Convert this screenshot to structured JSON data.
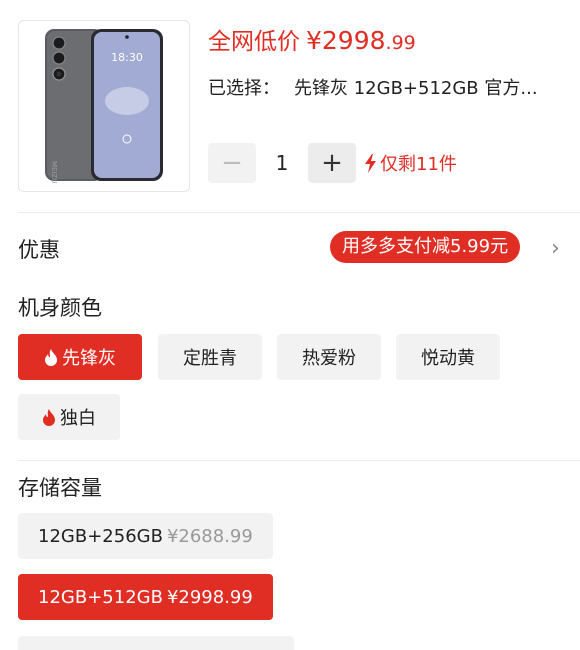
{
  "product": {
    "price_prefix": "全网低价",
    "price_main": "¥2998",
    "price_decimal": ".99",
    "selected_label": "已选择：",
    "selected_value": "先锋灰 12GB+512GB 官方...",
    "screen_time": "18:30",
    "brand_mark": "MEIZU"
  },
  "quantity": {
    "minus_label": "−",
    "value": "1",
    "plus_label": "+",
    "stock_text": "仅剩11件"
  },
  "promo": {
    "title": "优惠",
    "badge": "用多多支付减5.99元",
    "chevron": "›"
  },
  "color_section": {
    "title": "机身颜色",
    "options": [
      "先锋灰",
      "定胜青",
      "热爱粉",
      "悦动黄",
      "独白"
    ]
  },
  "storage_section": {
    "title": "存储容量",
    "options": [
      {
        "label": "12GB+256GB",
        "price": "¥2688.99"
      },
      {
        "label": "12GB+512GB",
        "price": "¥2998.99"
      }
    ]
  },
  "colors": {
    "accent": "#e02e24",
    "chip_bg": "#f2f2f2"
  },
  "icons": [
    "phone-image",
    "flash-icon",
    "flame-icon",
    "chevron-right-icon"
  ]
}
